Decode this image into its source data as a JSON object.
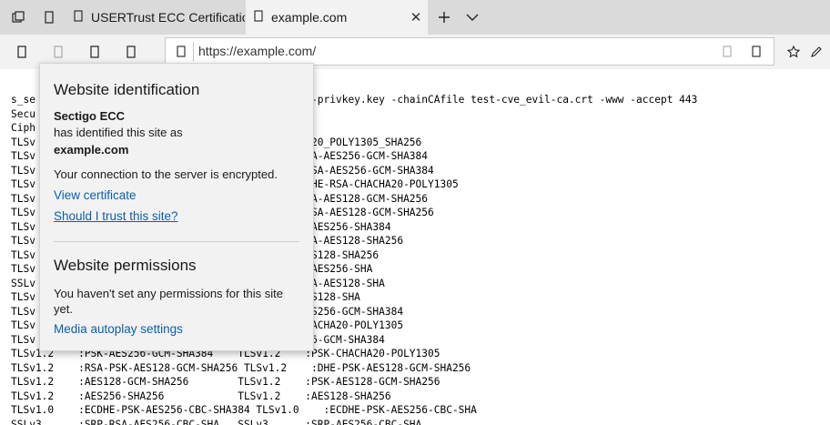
{
  "tabs": [
    {
      "label": "USERTrust ECC Certification",
      "icon": "page-icon"
    },
    {
      "label": "example.com",
      "icon": "page-icon",
      "close": "✕"
    }
  ],
  "toolbar": {
    "url": "https://example.com/"
  },
  "flyout": {
    "title": "Website identification",
    "issuer": "Sectigo ECC",
    "identified_text": "has identified this site as",
    "site": "example.com",
    "encrypted_text": "Your connection to the server is encrypted.",
    "view_certificate": "View certificate",
    "trust_link": "Should I trust this site?",
    "permissions_title": "Website permissions",
    "permissions_text_1": "You haven't set any permissions for this site",
    "permissions_text_2": "yet.",
    "media_link": "Media autoplay settings"
  },
  "terminal": {
    "lines": [
      "s_se                                  st-cve_host-privkey.key -chainCAfile test-cve_evil-ca.crt -www -accept 443",
      "Secu",
      "Ciph",
      "TLSv                                  :TLS_CHACHA20_POLY1305_SHA256",
      "TLSv                                  :ECDHE-ECDSA-AES256-GCM-SHA384",
      "TLSv                                 .2    :DHE-RSA-AES256-GCM-SHA384",
      "TLSv                                 v1.2    :ECDHE-RSA-CHACHA20-POLY1305",
      "TLSv                                  :ECDHE-ECDSA-AES128-GCM-SHA256",
      "TLSv                                 .2    :DHE-RSA-AES128-GCM-SHA256",
      "TLSv                                  :ECDHE-RSA-AES256-SHA384",
      "TLSv                                  :ECDHE-ECDSA-AES128-SHA256",
      "TLSv                                  :DHE-RSA-AES128-SHA256",
      "TLSv                                  :ECDHE-RSA-AES256-SHA",
      "SSLv                                  :ECDHE-ECDSA-AES128-SHA",
      "TLSv                                  :DHE-RSA-AES128-SHA",
      "TLSv                                  :DHE-PSK-AES256-GCM-SHA384",
      "TLSv                                  :DHE-PSK-CHACHA20-POLY1305",
      "TLSv                                 .2    :AES256-GCM-SHA384",
      "TLSv1.2    :PSK-AES256-GCM-SHA384    TLSv1.2    :PSK-CHACHA20-POLY1305",
      "TLSv1.2    :RSA-PSK-AES128-GCM-SHA256 TLSv1.2    :DHE-PSK-AES128-GCM-SHA256",
      "TLSv1.2    :AES128-GCM-SHA256        TLSv1.2    :PSK-AES128-GCM-SHA256",
      "TLSv1.2    :AES256-SHA256            TLSv1.2    :AES128-SHA256",
      "TLSv1.0    :ECDHE-PSK-AES256-CBC-SHA384 TLSv1.0    :ECDHE-PSK-AES256-CBC-SHA",
      "SSLv3      :SRP-RSA-AES256-CBC-SHA   SSLv3      :SRP-AES256-CBC-SHA"
    ]
  }
}
